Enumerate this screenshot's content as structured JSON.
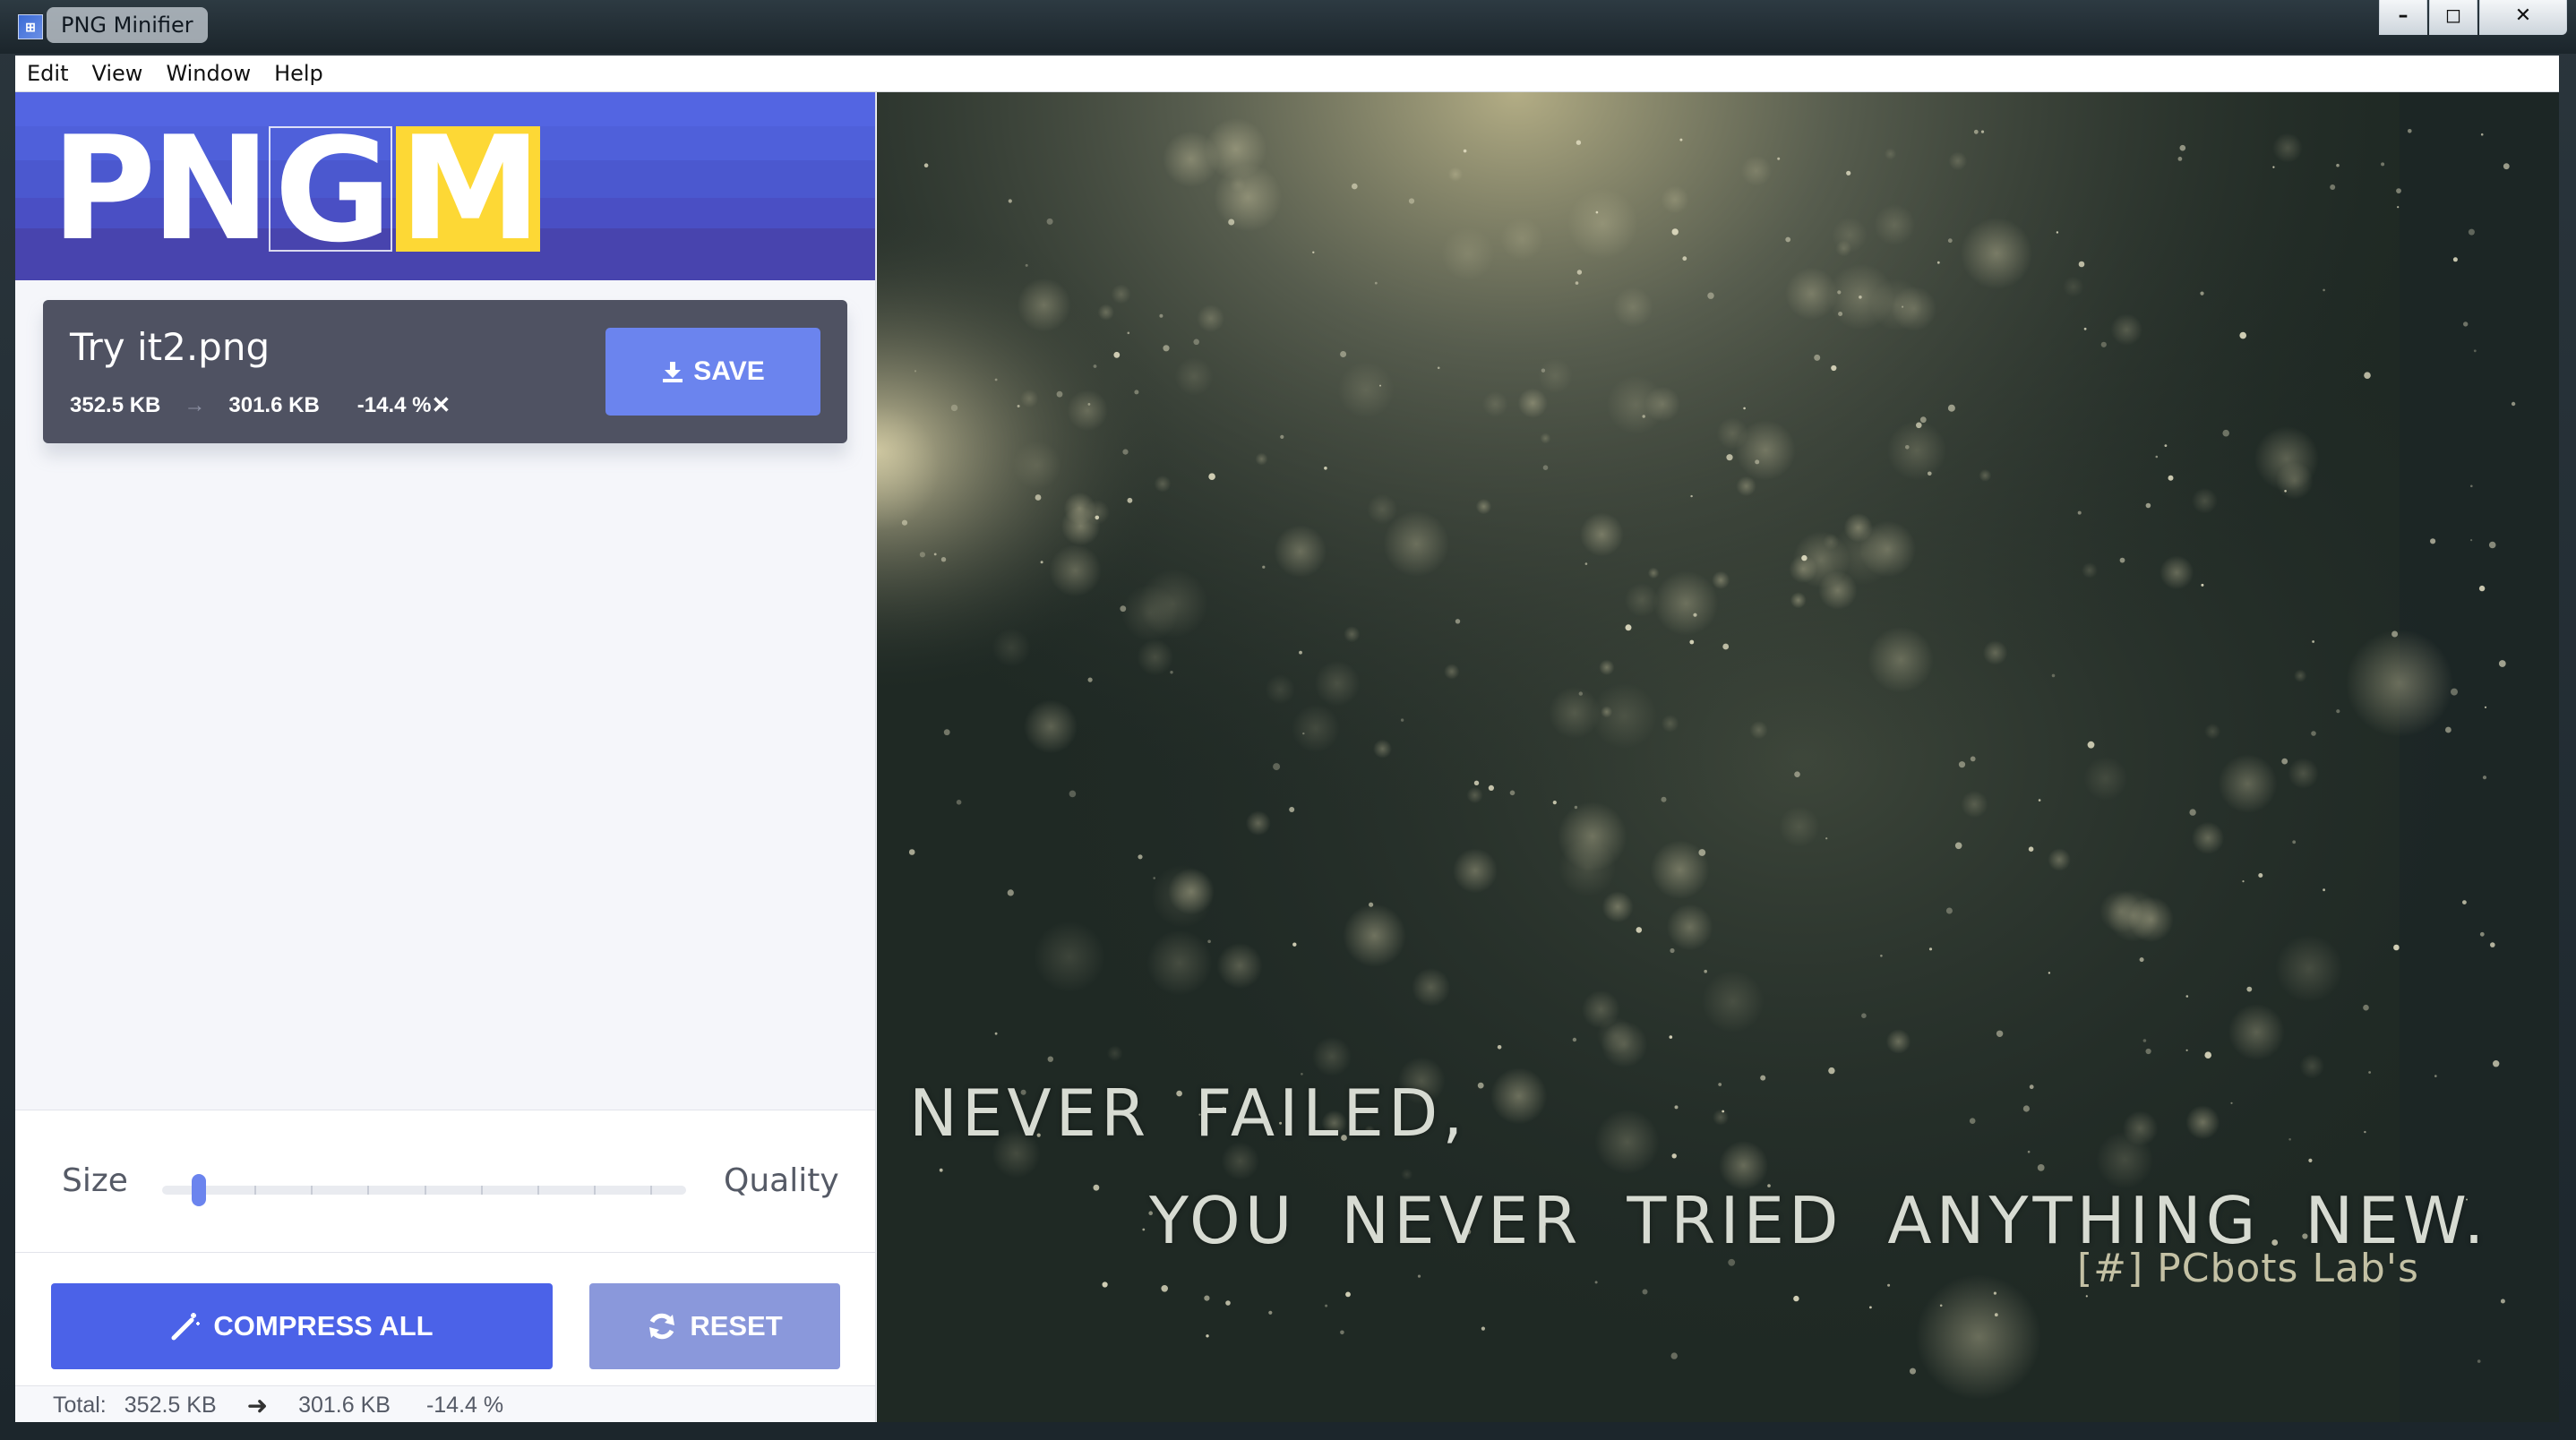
{
  "window": {
    "title": "PNG Minifier",
    "controls": {
      "minimize": "–",
      "maximize": "◻",
      "close": "✕"
    }
  },
  "menu": [
    "Edit",
    "View",
    "Window",
    "Help"
  ],
  "logo": {
    "letters": [
      "P",
      "N",
      "G",
      "M"
    ],
    "accent_color": "#FDD835",
    "band_color": "#4F5FDB"
  },
  "file": {
    "name": "Try it2.png",
    "original_size": "352.5 KB",
    "arrow": "→",
    "new_size": "301.6 KB",
    "reduction": "-14.4 %",
    "remove_icon": "✕",
    "save_label": "SAVE",
    "save_icon": "download-icon"
  },
  "slider": {
    "left_label": "Size",
    "right_label": "Quality",
    "value_fraction": 0.07,
    "tick_count": 9
  },
  "actions": {
    "compress_label": "COMPRESS ALL",
    "compress_icon": "magic-wand-icon",
    "reset_label": "RESET",
    "reset_icon": "refresh-icon"
  },
  "total": {
    "label": "Total:",
    "original_size": "352.5 KB",
    "arrow": "➜",
    "new_size": "301.6 KB",
    "reduction": "-14.4 %"
  },
  "preview": {
    "line1": "NEVER FAILED,",
    "line2": "YOU NEVER TRIED ANYTHING NEW.",
    "watermark": "[#] PCbots Lab's"
  },
  "colors": {
    "primary": "#4B62E8",
    "save": "#6B84EE",
    "reset": "#8A98DB",
    "card": "#4F5262"
  }
}
